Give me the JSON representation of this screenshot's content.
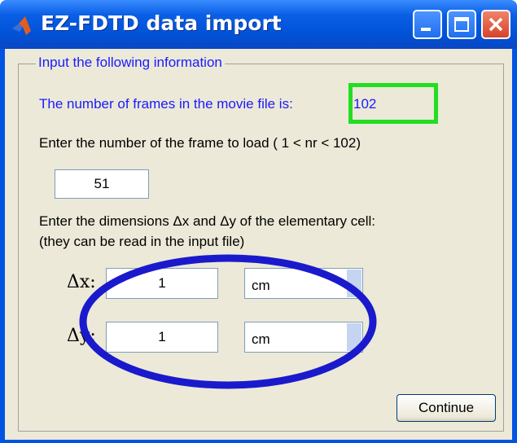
{
  "window": {
    "title": "EZ-FDTD data import",
    "buttons": {
      "minimize": "minimize",
      "maximize": "maximize",
      "close": "close"
    }
  },
  "group": {
    "title": "Input the following information"
  },
  "frames": {
    "label": "The number of frames in the movie file is:",
    "value": "102"
  },
  "frame_prompt": "Enter the number of the frame to load ( 1 < nr < 102)",
  "frame_input": {
    "value": "51"
  },
  "dims_prompt": {
    "line1": "Enter the dimensions Δx and Δy of the elementary cell:",
    "line2": "(they can be read in the input file)"
  },
  "dx": {
    "label": "Δx:",
    "value": "1",
    "unit": "cm"
  },
  "dy": {
    "label": "Δy:",
    "value": "1",
    "unit": "cm"
  },
  "continue_button": "Continue",
  "colors": {
    "title_bar": "#0054e3",
    "dialog_bg": "#ece9d8",
    "label_blue": "#1a1aff",
    "highlight_green": "#22dd22",
    "highlight_blue": "#1a1acc"
  },
  "icons": {
    "app": "matlab-icon",
    "minimize": "minimize-icon",
    "maximize": "maximize-icon",
    "close": "close-icon",
    "dropdown": "chevron-down-icon"
  }
}
